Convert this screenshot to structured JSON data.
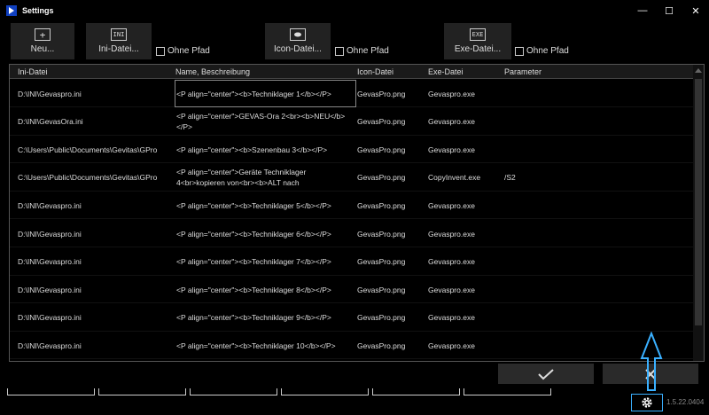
{
  "window": {
    "title": "Settings",
    "minimize": "—",
    "maximize": "☐",
    "close": "✕"
  },
  "toolbar": {
    "new_label": "Neu...",
    "new_icon": "plus-icon",
    "ini_label": "Ini-Datei...",
    "ini_icon_text": "INI",
    "ini_ohne_pfad": "Ohne Pfad",
    "icon_label": "Icon-Datei...",
    "icon_ohne_pfad": "Ohne Pfad",
    "exe_label": "Exe-Datei...",
    "exe_icon_text": "EXE",
    "exe_ohne_pfad": "Ohne Pfad"
  },
  "grid": {
    "headers": [
      "Ini-Datei",
      "Name, Beschreibung",
      "Icon-Datei",
      "Exe-Datei",
      "Parameter"
    ],
    "rows": [
      {
        "ini": "D:\\INI\\Gevaspro.ini",
        "name": "<P align=\"center\"><b>Techniklager 1</b></P>",
        "icon": "GevasPro.png",
        "exe": "Gevaspro.exe",
        "param": ""
      },
      {
        "ini": "D:\\INI\\GevasOra.ini",
        "name": "<P align=\"center\">GEVAS-Ora 2<br><b>NEU</b></P>",
        "icon": "GevasPro.png",
        "exe": "Gevaspro.exe",
        "param": ""
      },
      {
        "ini": "C:\\Users\\Public\\Documents\\Gevitas\\GPro",
        "name": "<P align=\"center\"><b>Szenenbau 3</b></P>",
        "icon": "GevasPro.png",
        "exe": "Gevaspro.exe",
        "param": ""
      },
      {
        "ini": "C:\\Users\\Public\\Documents\\Gevitas\\GPro",
        "name": "<P align=\"center\">Geräte Techniklager 4<br>kopieren von<br><b>ALT nach",
        "icon": "GevasPro.png",
        "exe": "CopyInvent.exe",
        "param": "/S2"
      },
      {
        "ini": "D:\\INI\\Gevaspro.ini",
        "name": "<P align=\"center\"><b>Techniklager 5</b></P>",
        "icon": "GevasPro.png",
        "exe": "Gevaspro.exe",
        "param": ""
      },
      {
        "ini": "D:\\INI\\Gevaspro.ini",
        "name": "<P align=\"center\"><b>Techniklager 6</b></P>",
        "icon": "GevasPro.png",
        "exe": "Gevaspro.exe",
        "param": ""
      },
      {
        "ini": "D:\\INI\\Gevaspro.ini",
        "name": "<P align=\"center\"><b>Techniklager 7</b></P>",
        "icon": "GevasPro.png",
        "exe": "Gevaspro.exe",
        "param": ""
      },
      {
        "ini": "D:\\INI\\Gevaspro.ini",
        "name": "<P align=\"center\"><b>Techniklager 8</b></P>",
        "icon": "GevasPro.png",
        "exe": "Gevaspro.exe",
        "param": ""
      },
      {
        "ini": "D:\\INI\\Gevaspro.ini",
        "name": "<P align=\"center\"><b>Techniklager 9</b></P>",
        "icon": "GevasPro.png",
        "exe": "Gevaspro.exe",
        "param": ""
      },
      {
        "ini": "D:\\INI\\Gevaspro.ini",
        "name": "<P align=\"center\"><b>Techniklager 10</b></P>",
        "icon": "GevasPro.png",
        "exe": "Gevaspro.exe",
        "param": ""
      }
    ]
  },
  "footer": {
    "ok_icon": "checkmark-icon",
    "cancel_icon": "x-icon",
    "gear_icon": "gear-icon",
    "version": "1.5.22.0404",
    "highlight_color": "#3ab0ff"
  }
}
